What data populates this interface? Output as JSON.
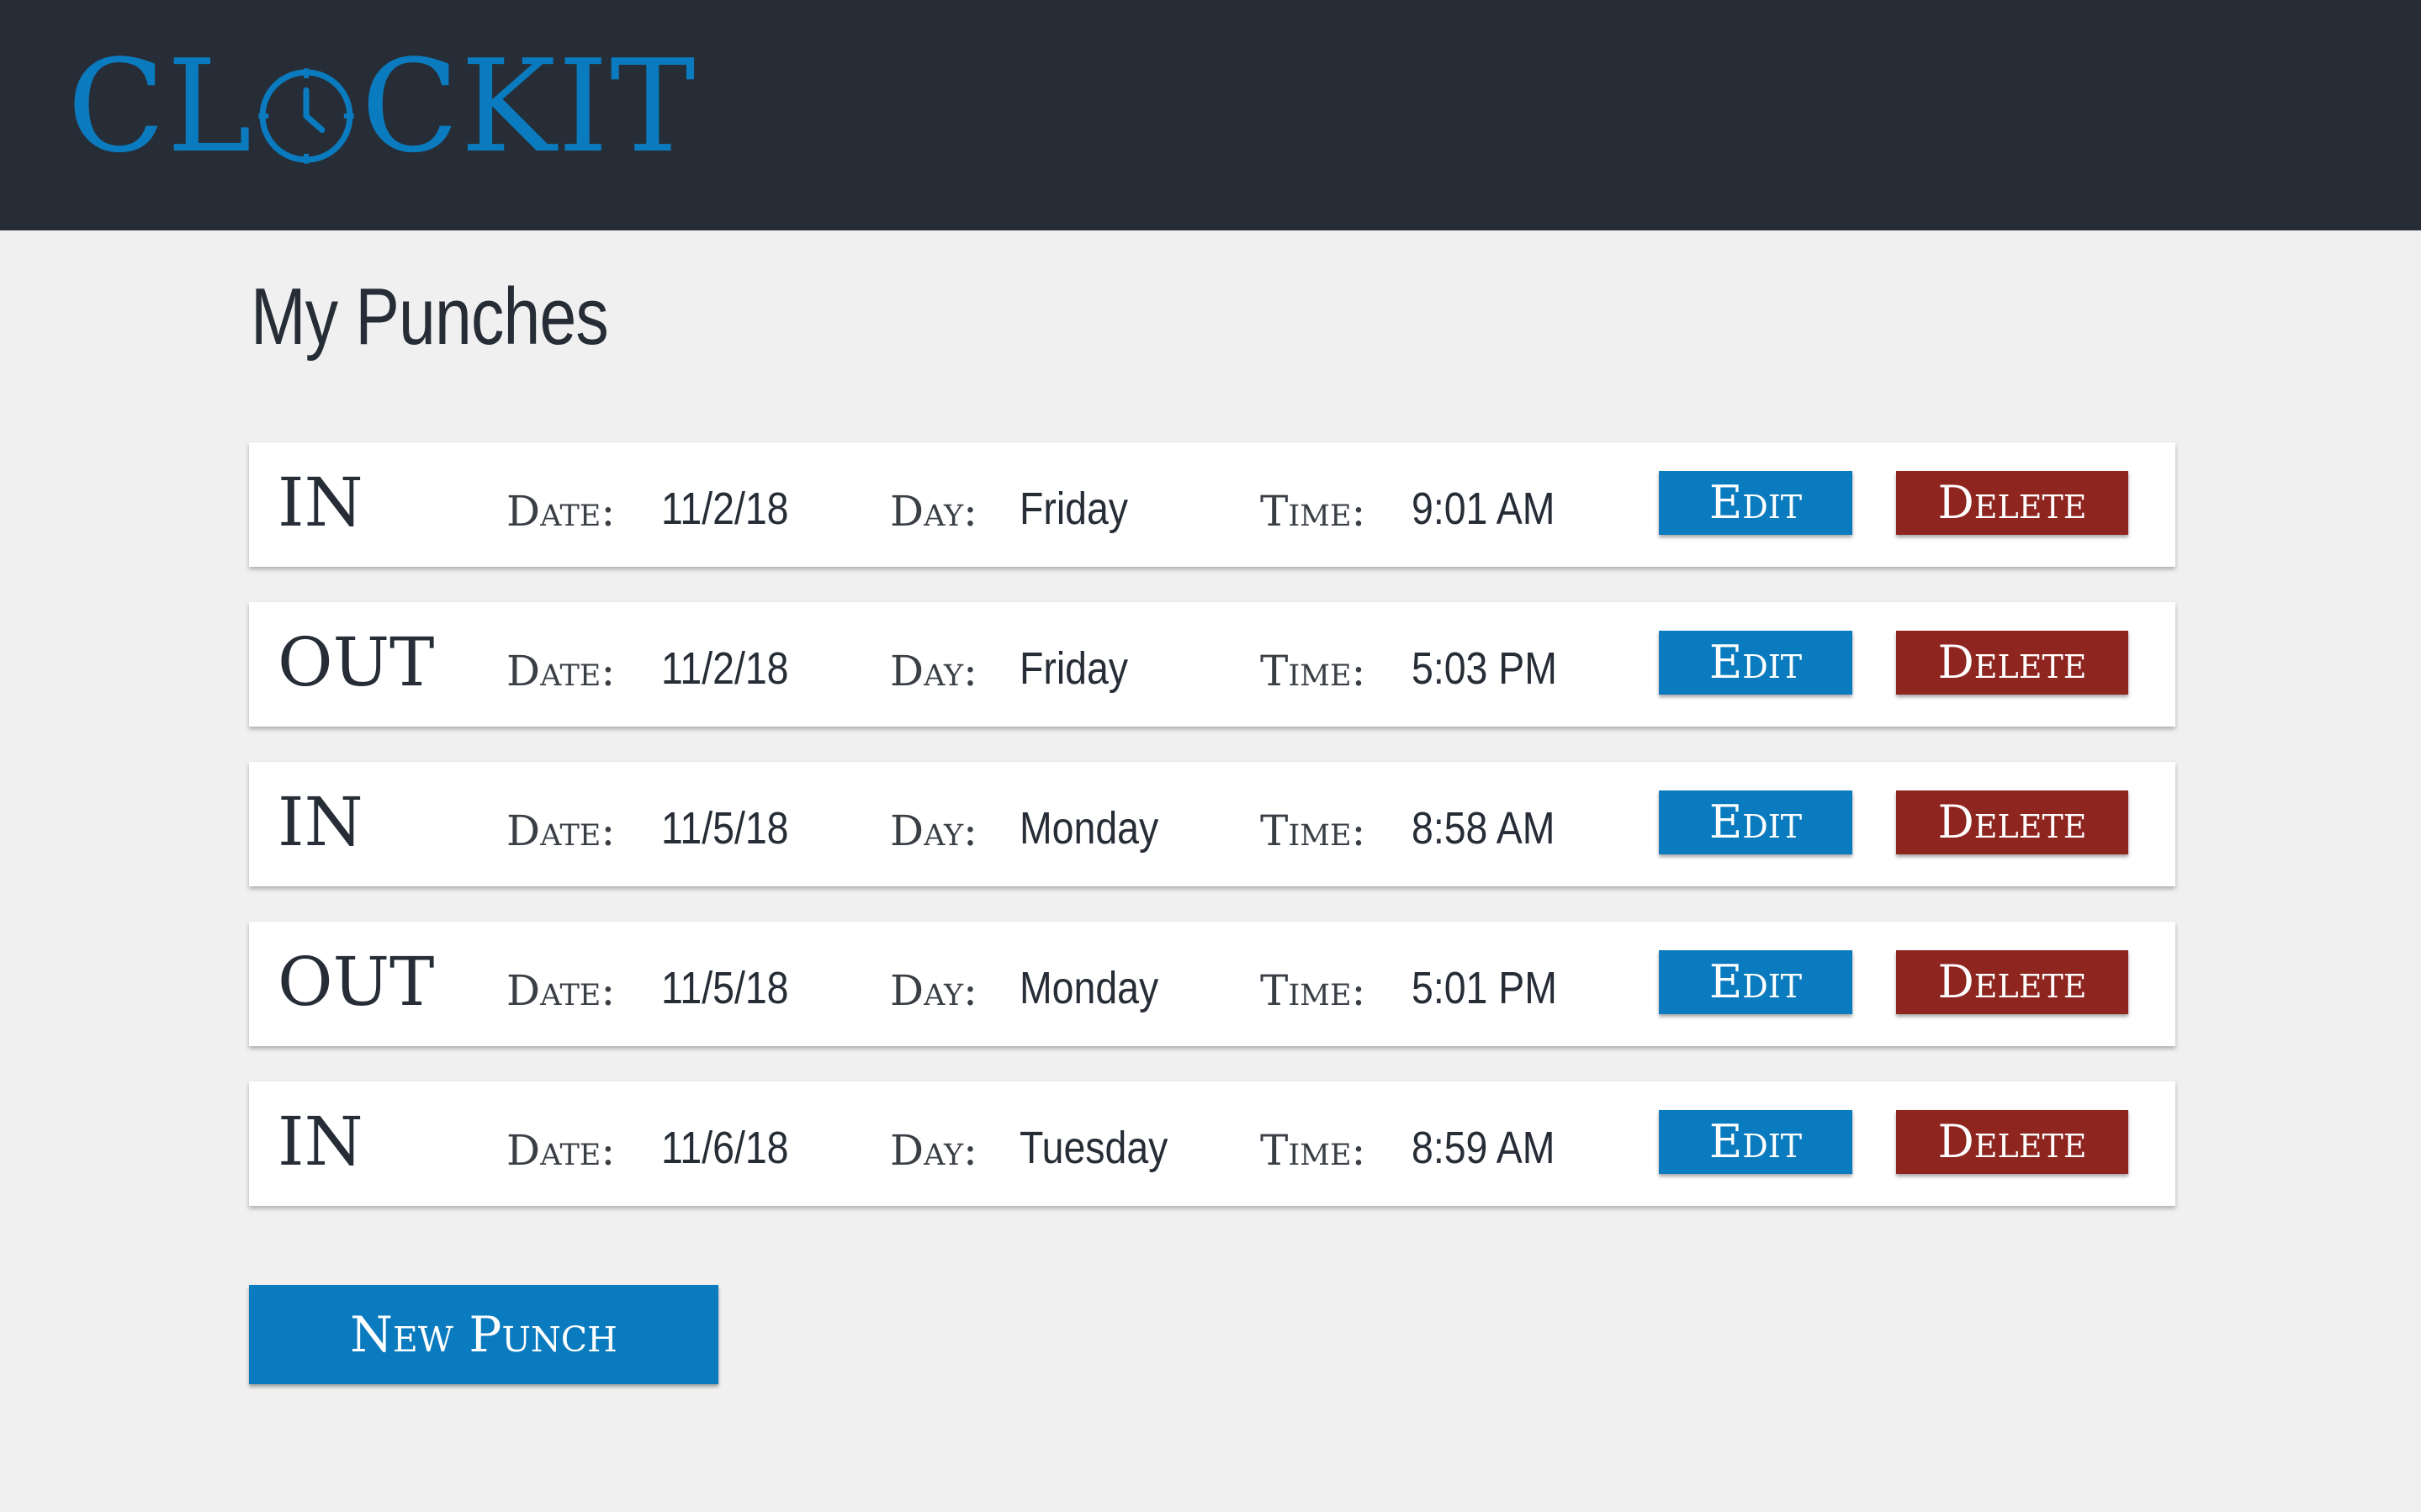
{
  "header": {
    "logo": {
      "text_before": "CL",
      "text_after": "CKIT",
      "icon": "clock-icon",
      "color": "#0b7bbf"
    }
  },
  "main": {
    "title": "My Punches",
    "labels": {
      "date": "Date:",
      "day": "Day:",
      "time": "Time:"
    },
    "buttons": {
      "edit": "Edit",
      "delete": "Delete",
      "new_punch": "New Punch"
    },
    "punches": [
      {
        "type": "IN",
        "date": "11/2/18",
        "day": "Friday",
        "time": "9:01 AM"
      },
      {
        "type": "OUT",
        "date": "11/2/18",
        "day": "Friday",
        "time": "5:03 PM"
      },
      {
        "type": "IN",
        "date": "11/5/18",
        "day": "Monday",
        "time": "8:58 AM"
      },
      {
        "type": "OUT",
        "date": "11/5/18",
        "day": "Monday",
        "time": "5:01 PM"
      },
      {
        "type": "IN",
        "date": "11/6/18",
        "day": "Tuesday",
        "time": "8:59 AM"
      }
    ]
  },
  "colors": {
    "header_bg": "#262d36",
    "page_bg": "#f0f0f0",
    "primary": "#0b7bbf",
    "danger": "#8f251f"
  }
}
